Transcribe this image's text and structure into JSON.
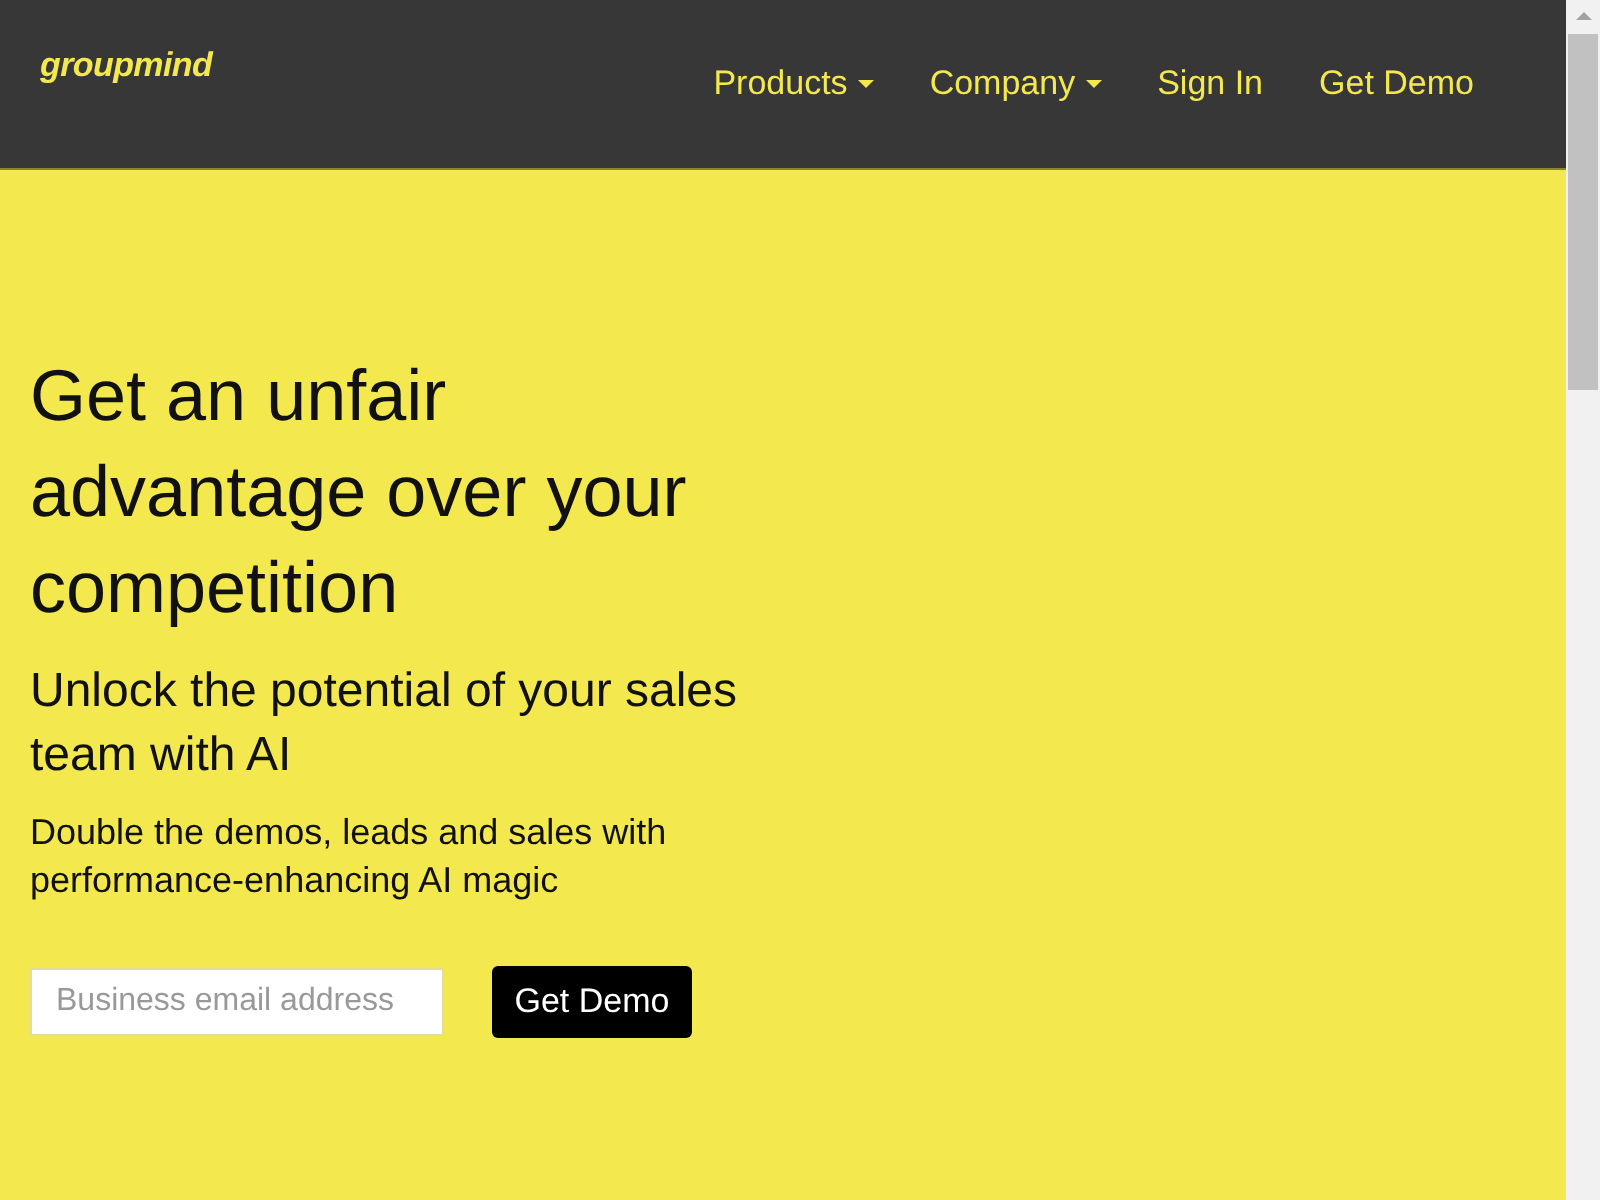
{
  "header": {
    "logo": "groupmind",
    "nav": [
      {
        "label": "Products",
        "dropdown": true
      },
      {
        "label": "Company",
        "dropdown": true
      },
      {
        "label": "Sign In",
        "dropdown": false
      },
      {
        "label": "Get Demo",
        "dropdown": false
      }
    ]
  },
  "hero": {
    "title": "Get an unfair advantage over your competition",
    "subtitle": "Unlock the potential of your sales team with AI",
    "text": "Double the demos, leads and sales with performance-enhancing AI magic",
    "form": {
      "email": {
        "placeholder": "Business email address"
      },
      "button": "Get Demo"
    }
  }
}
